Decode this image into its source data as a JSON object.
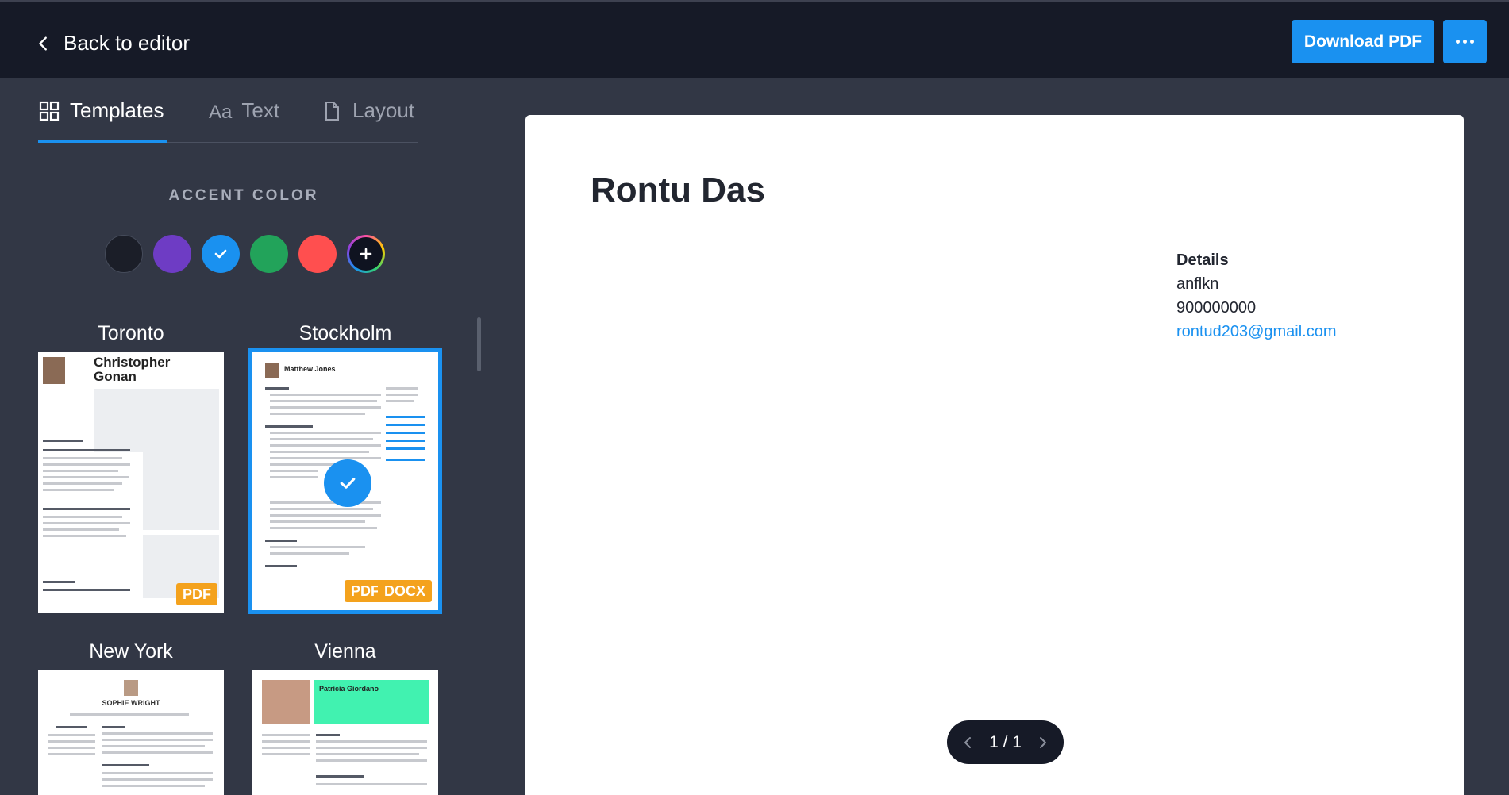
{
  "header": {
    "back_label": "Back to editor",
    "download_label": "Download PDF",
    "more_icon": "more-horizontal-icon"
  },
  "sidebar": {
    "tabs": [
      {
        "label": "Templates",
        "icon": "grid-icon",
        "active": true
      },
      {
        "label": "Text",
        "icon": "text-aa-icon",
        "icon_text": "Aa",
        "active": false
      },
      {
        "label": "Layout",
        "icon": "document-icon",
        "active": false
      }
    ],
    "accent_title": "ACCENT COLOR",
    "accent_colors": [
      "#1b1e28",
      "#6e3cc4",
      "#1a91f0",
      "#22a35a",
      "#ff4f4f"
    ],
    "selected_accent": "#1a91f0",
    "templates": [
      {
        "name": "Toronto",
        "badges": [
          "PDF"
        ],
        "mini_name": "Christopher Gonan",
        "selected": false
      },
      {
        "name": "Stockholm",
        "badges": [
          "PDF",
          "DOCX"
        ],
        "mini_name": "Matthew Jones",
        "selected": true
      },
      {
        "name": "New York",
        "badges": [],
        "mini_name": "SOPHIE WRIGHT",
        "selected": false
      },
      {
        "name": "Vienna",
        "badges": [],
        "mini_name": "Patricia Giordano",
        "selected": false
      }
    ]
  },
  "preview": {
    "name": "Rontu Das",
    "details_heading": "Details",
    "details_line1": "anflkn",
    "details_phone": "900000000",
    "details_email": "rontud203@gmail.com",
    "page_indicator": "1 / 1"
  }
}
